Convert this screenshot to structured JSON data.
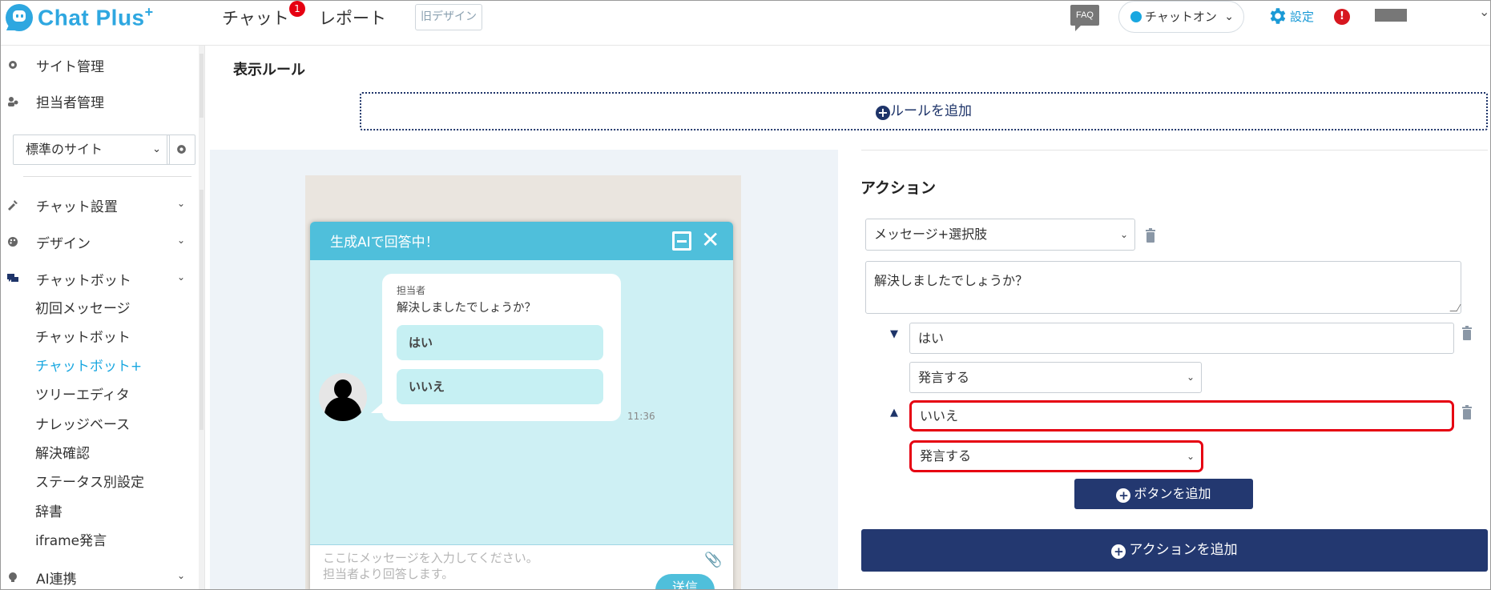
{
  "header": {
    "logo_text": "Chat Plus",
    "logo_plus": "+",
    "nav_chat": "チャット",
    "nav_chat_badge": "1",
    "nav_report": "レポート",
    "old_design": "旧デザイン",
    "faq": "FAQ",
    "chat_status": "チャットオン",
    "settings": "設定",
    "alert": "!"
  },
  "sidebar": {
    "site_management": "サイト管理",
    "staff_management": "担当者管理",
    "site_select": "標準のサイト",
    "sections": [
      {
        "label": "チャット設置"
      },
      {
        "label": "デザイン"
      },
      {
        "label": "チャットボット"
      },
      {
        "label": "AI連携"
      }
    ],
    "chatbot_items": [
      "初回メッセージ",
      "チャットボット",
      "チャットボット+",
      "ツリーエディタ",
      "ナレッジベース",
      "解決確認",
      "ステータス別設定",
      "辞書",
      "iframe発言"
    ],
    "active_item": "チャットボット+"
  },
  "main": {
    "rule_title": "表示ルール",
    "add_rule": "ルールを追加",
    "action_title": "アクション",
    "action_type": "メッセージ+選択肢",
    "message_text": "解決しましたでしょうか？",
    "choices": [
      {
        "label": "はい",
        "behavior": "発言する"
      },
      {
        "label": "いいえ",
        "behavior": "発言する"
      }
    ],
    "add_button": "ボタンを追加",
    "add_action": "アクションを追加"
  },
  "preview": {
    "widget_title": "生成AIで回答中！",
    "sender": "担当者",
    "message": "解決しましたでしょうか？",
    "choice_yes": "はい",
    "choice_no": "いいえ",
    "time": "11:36",
    "input_placeholder_1": "ここにメッセージを入力してください。",
    "input_placeholder_2": "担当者より回答します。",
    "send": "送信"
  },
  "colors": {
    "brand": "#2ea7e0",
    "navy": "#233870",
    "widget_header": "#4fbfdb",
    "highlight": "#e60012"
  }
}
